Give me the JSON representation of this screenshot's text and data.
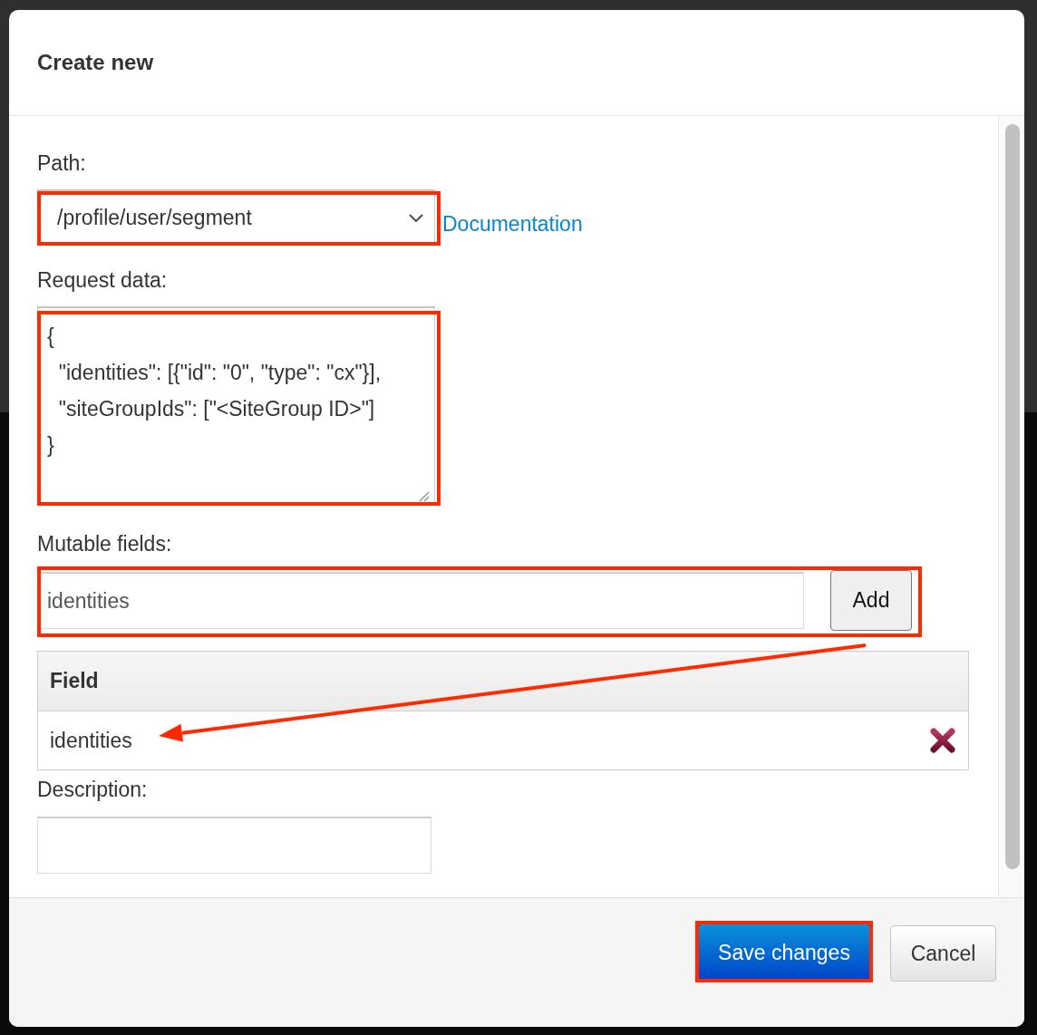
{
  "dialog": {
    "title": "Create new"
  },
  "path": {
    "label": "Path:",
    "value": "/profile/user/segment",
    "link": "Documentation",
    "highlighted": true
  },
  "request_data": {
    "label": "Request data:",
    "value": "{\n  \"identities\": [{\"id\": \"0\", \"type\": \"cx\"}],\n  \"siteGroupIds\": [\"<SiteGroup ID>\"]\n}",
    "highlighted": true
  },
  "mutable_fields": {
    "label": "Mutable fields:",
    "value": "identities",
    "button": "Add",
    "highlighted": true,
    "table": {
      "columns": [
        "Field"
      ],
      "rows": [
        {
          "field": "identities"
        }
      ]
    }
  },
  "description": {
    "label": "Description:"
  },
  "footer": {
    "buttons": [
      {
        "label": "Save changes",
        "kind": "primary",
        "highlighted": true
      },
      {
        "label": "Cancel",
        "kind": "secondary",
        "highlighted": false
      }
    ]
  }
}
